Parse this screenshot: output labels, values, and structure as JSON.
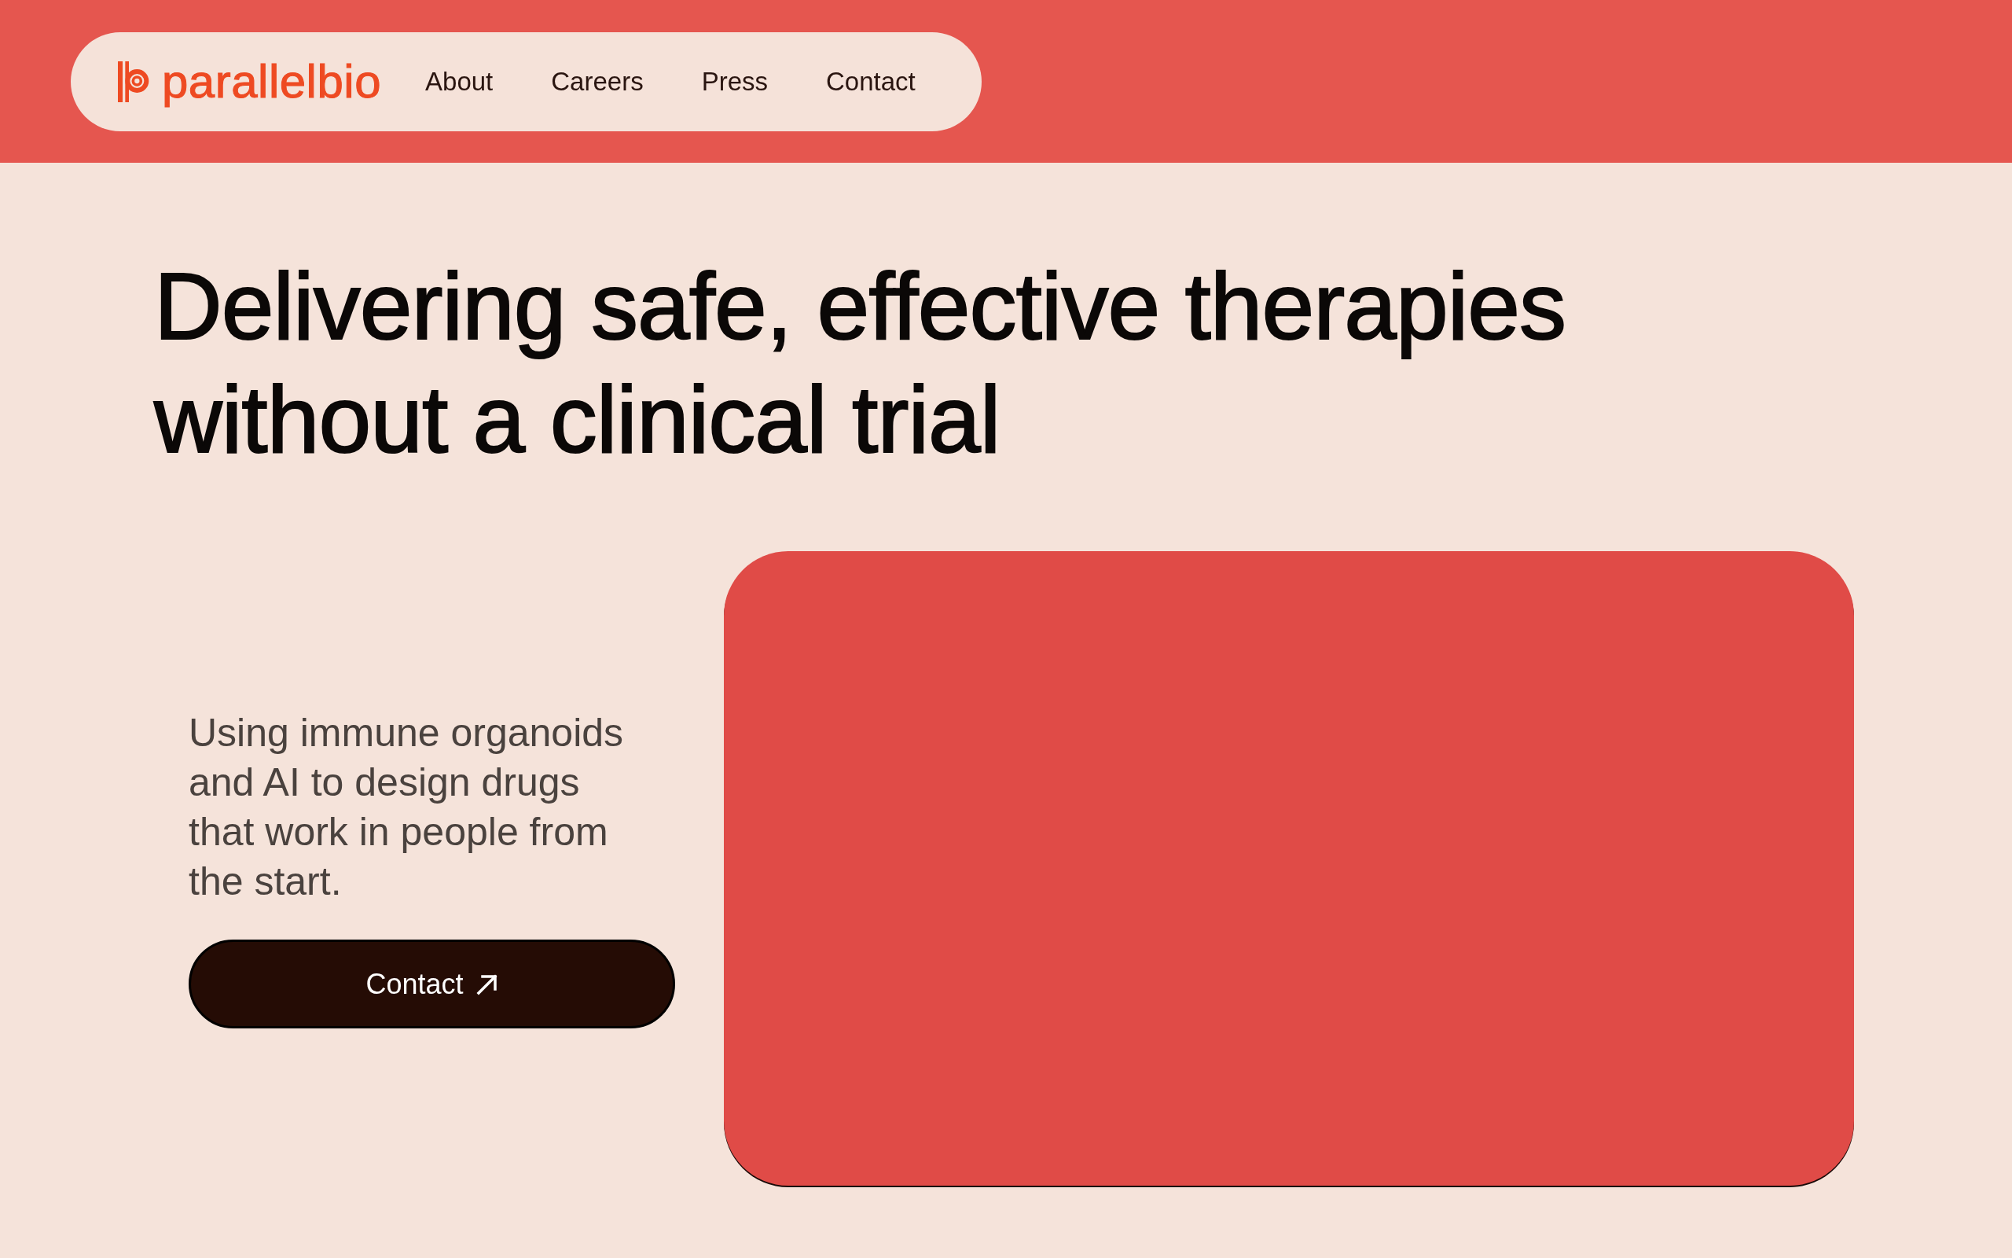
{
  "header": {
    "logo": {
      "text": "parallelbio"
    },
    "nav": [
      {
        "label": "About"
      },
      {
        "label": "Careers"
      },
      {
        "label": "Press"
      },
      {
        "label": "Contact"
      }
    ]
  },
  "hero": {
    "heading": "Delivering safe, effective therapies without a clinical trial",
    "subtitle": "Using immune organoids and AI to design drugs that work in people from the start.",
    "button": {
      "label": "Contact"
    }
  }
}
